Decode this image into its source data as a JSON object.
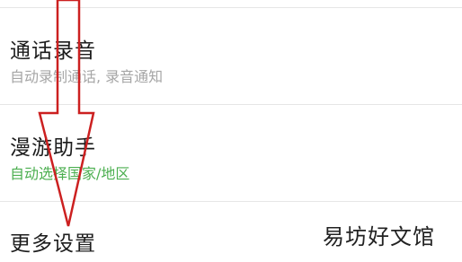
{
  "settings": {
    "items": [
      {
        "title": "通话录音",
        "subtitle": "自动录制通话, 录音通知",
        "subtitle_color": "#a6a6a6"
      },
      {
        "title": "漫游助手",
        "subtitle": "自动选择国家/地区",
        "subtitle_color": "#4caf50"
      },
      {
        "title": "更多设置"
      }
    ]
  },
  "annotation": {
    "arrow_color": "#cc2020",
    "icon": "down-arrow-icon"
  },
  "watermark": "易坊好文馆"
}
